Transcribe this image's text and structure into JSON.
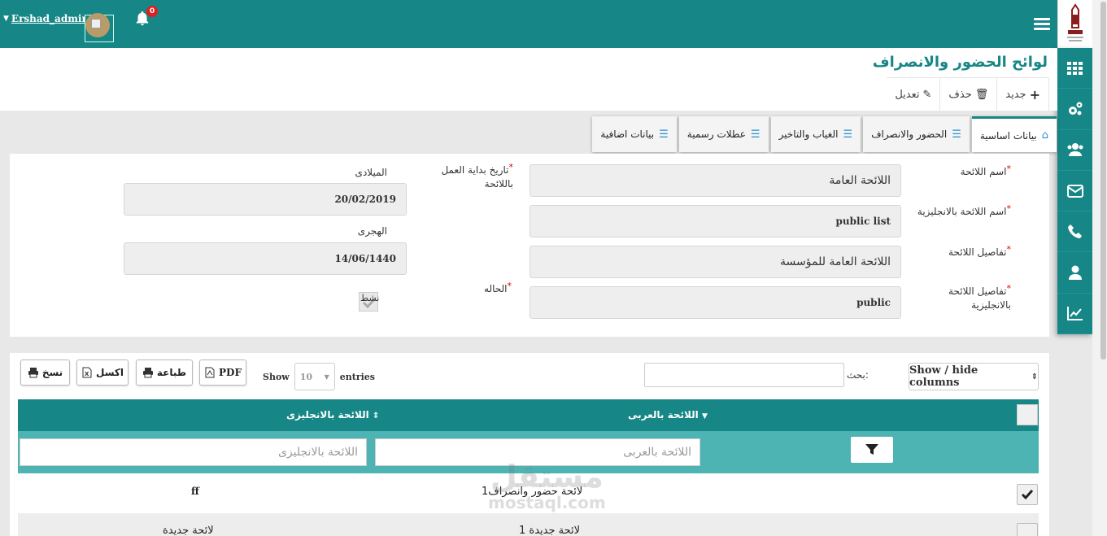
{
  "header": {
    "username": "Ershad_admin",
    "notification_count": "0"
  },
  "page": {
    "title": "لوائح الحضور والانصراف"
  },
  "toolbar": {
    "new_label": "جديد",
    "delete_label": "حذف",
    "edit_label": "تعديل"
  },
  "tabs": [
    {
      "label": "بيانات اساسية",
      "active": true
    },
    {
      "label": "الحضور والانصراف",
      "active": false
    },
    {
      "label": "الغياب والتاخير",
      "active": false
    },
    {
      "label": "عطلات رسمية",
      "active": false
    },
    {
      "label": "بيانات اضافية",
      "active": false
    }
  ],
  "form": {
    "name_label": "اسم اللائحة",
    "name_value": "اللائحة العامة",
    "name_en_label": "اسم اللائحة بالانجليزية",
    "name_en_value": "public list",
    "details_label": "تفاصيل اللائحة",
    "details_value": "اللائحة العامة للمؤسسة",
    "details_en_label": "تفاصيل اللائحة بالانجليزية",
    "details_en_value": "public",
    "start_date_label": "تاريخ بداية العمل باللائحة",
    "gregorian_label": "الميلادى",
    "gregorian_value": "20/02/2019",
    "hijri_label": "الهجرى",
    "hijri_value": "14/06/1440",
    "status_label": "الحاله",
    "status_check_label": "نشط"
  },
  "table_controls": {
    "copy_label": "نسخ",
    "excel_label": "اكسل",
    "print_label": "طباعة",
    "pdf_label": "PDF",
    "show_label": "Show",
    "entries_value": "10",
    "entries_label": "entries",
    "search_label": "بحث:",
    "colvis_label": "Show / hide columns"
  },
  "table": {
    "columns": [
      "اللائحة بالعربى",
      "اللائحة بالانجليزى"
    ],
    "filter_placeholders": [
      "اللائحة بالعربى",
      "اللائحة بالانجليزى"
    ],
    "rows": [
      {
        "ar": "لائحة حضور وانصراف1",
        "en": "ff",
        "checked": true
      },
      {
        "ar": "لائحة جديدة 1",
        "en": "لائحة جديدة",
        "checked": false
      }
    ]
  },
  "watermark": {
    "arabic": "مستقل",
    "latin": "mostaql.com"
  },
  "colors": {
    "primary": "#168686",
    "filter_row": "#4db3b3",
    "required": "#dd0000"
  },
  "icons": [
    "bars-icon",
    "bell-icon",
    "grid-icon",
    "gears-icon",
    "users-icon",
    "envelope-icon",
    "phone-icon",
    "user-icon",
    "chart-icon",
    "home-icon",
    "list-icon",
    "print-icon",
    "file-excel-icon",
    "file-pdf-icon",
    "filter-icon",
    "check-icon",
    "sort-icon"
  ]
}
